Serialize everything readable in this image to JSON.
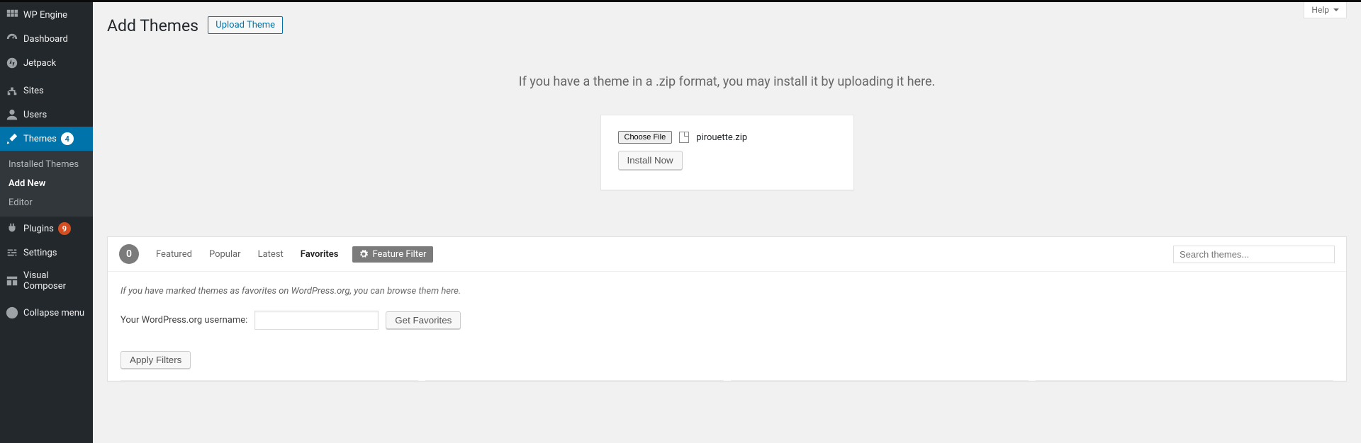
{
  "header": {
    "title": "Add Themes",
    "upload_button": "Upload Theme",
    "help_label": "Help"
  },
  "sidebar": {
    "items": [
      {
        "id": "wpengine",
        "label": "WP Engine"
      },
      {
        "id": "dashboard",
        "label": "Dashboard"
      },
      {
        "id": "jetpack",
        "label": "Jetpack"
      },
      {
        "id": "sites",
        "label": "Sites"
      },
      {
        "id": "users",
        "label": "Users"
      },
      {
        "id": "themes",
        "label": "Themes",
        "badge": "4",
        "current": true
      },
      {
        "id": "plugins",
        "label": "Plugins",
        "badge": "9"
      },
      {
        "id": "settings",
        "label": "Settings"
      },
      {
        "id": "vc",
        "label": "Visual Composer"
      },
      {
        "id": "collapse",
        "label": "Collapse menu"
      }
    ],
    "submenu": [
      {
        "id": "installed",
        "label": "Installed Themes"
      },
      {
        "id": "addnew",
        "label": "Add New",
        "active": true
      },
      {
        "id": "editor",
        "label": "Editor"
      }
    ]
  },
  "upload": {
    "instruction": "If you have a theme in a .zip format, you may install it by uploading it here.",
    "choose_file": "Choose File",
    "selected_file": "pirouette.zip",
    "install_now": "Install Now"
  },
  "browser": {
    "count": "0",
    "tabs": {
      "featured": "Featured",
      "popular": "Popular",
      "latest": "Latest",
      "favorites": "Favorites",
      "feature_filter": "Feature Filter"
    },
    "search_placeholder": "Search themes...",
    "favorites_note": "If you have marked themes as favorites on WordPress.org, you can browse them here.",
    "username_label": "Your WordPress.org username:",
    "get_favorites": "Get Favorites",
    "apply_filters": "Apply Filters"
  }
}
